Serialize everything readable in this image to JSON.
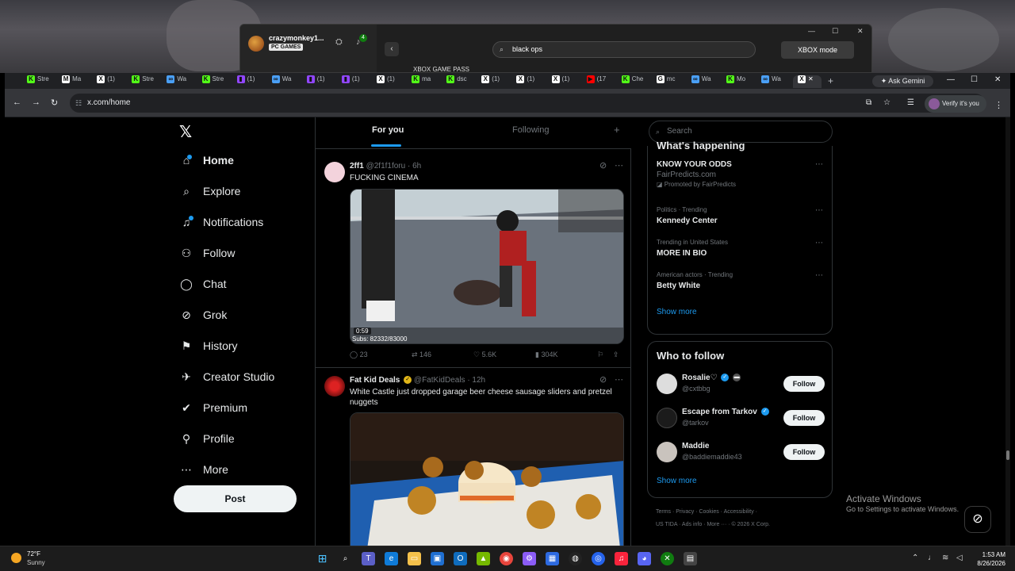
{
  "xbox": {
    "username": "crazymonkey1...",
    "badge": "PC GAMES",
    "notif_count": "4",
    "search_value": "black ops",
    "mode_label": "XBOX mode",
    "game_pass": "XBOX GAME PASS"
  },
  "browser": {
    "tabs": [
      {
        "label": "Stre",
        "fav": "K",
        "color": "#53fc18"
      },
      {
        "label": "Ma",
        "fav": "M",
        "color": "#ffffff"
      },
      {
        "label": "(1)",
        "fav": "X",
        "color": "#ffffff"
      },
      {
        "label": "Stre",
        "fav": "K",
        "color": "#53fc18"
      },
      {
        "label": "Wa",
        "fav": "∞",
        "color": "#4a9ff5"
      },
      {
        "label": "Stre",
        "fav": "K",
        "color": "#53fc18"
      },
      {
        "label": "(1)",
        "fav": "▮",
        "color": "#9146ff"
      },
      {
        "label": "Wa",
        "fav": "∞",
        "color": "#4a9ff5"
      },
      {
        "label": "(1)",
        "fav": "▮",
        "color": "#9146ff"
      },
      {
        "label": "(1)",
        "fav": "▮",
        "color": "#9146ff"
      },
      {
        "label": "(1)",
        "fav": "X",
        "color": "#ffffff"
      },
      {
        "label": "ma",
        "fav": "K",
        "color": "#53fc18"
      },
      {
        "label": "dsc",
        "fav": "K",
        "color": "#53fc18"
      },
      {
        "label": "(1)",
        "fav": "X",
        "color": "#ffffff"
      },
      {
        "label": "(1)",
        "fav": "X",
        "color": "#ffffff"
      },
      {
        "label": "(1)",
        "fav": "X",
        "color": "#ffffff"
      },
      {
        "label": "(17",
        "fav": "▶",
        "color": "#ff0000"
      },
      {
        "label": "Che",
        "fav": "K",
        "color": "#53fc18"
      },
      {
        "label": "mc",
        "fav": "G",
        "color": "#ffffff"
      },
      {
        "label": "Wa",
        "fav": "∞",
        "color": "#4a9ff5"
      },
      {
        "label": "Mo",
        "fav": "K",
        "color": "#53fc18"
      },
      {
        "label": "Wa",
        "fav": "∞",
        "color": "#4a9ff5"
      }
    ],
    "active_tab": {
      "fav": "X",
      "close": "✕"
    },
    "new_tab": "+",
    "gemini": "Ask Gemini",
    "url": "x.com/home",
    "verify": "Verify it's you"
  },
  "nav": {
    "logo": "𝕏",
    "items": [
      {
        "label": "Home",
        "icon": "⌂"
      },
      {
        "label": "Explore",
        "icon": "⌕"
      },
      {
        "label": "Notifications",
        "icon": "♫"
      },
      {
        "label": "Follow",
        "icon": "⚇"
      },
      {
        "label": "Chat",
        "icon": "◯"
      },
      {
        "label": "Grok",
        "icon": "⊘"
      },
      {
        "label": "History",
        "icon": "⚑"
      },
      {
        "label": "Creator Studio",
        "icon": "✈"
      },
      {
        "label": "Premium",
        "icon": "✔"
      },
      {
        "label": "Profile",
        "icon": "⚲"
      },
      {
        "label": "More",
        "icon": "⋯"
      }
    ],
    "post": "Post"
  },
  "feed": {
    "tabs": [
      "For you",
      "Following"
    ],
    "tweet1": {
      "name": "2ff1",
      "handle": "@2f1f1foru · 6h",
      "text": "FUCKING CINEMA",
      "timer": "0:59",
      "overlay": "Subs: 82332/83000",
      "replies": "23",
      "reposts": "146",
      "likes": "5.6K",
      "views": "304K"
    },
    "tweet2": {
      "name": "Fat Kid Deals",
      "handle": "@FatKidDeals · 12h",
      "text": "White Castle just dropped garage beer cheese sausage sliders and pretzel nuggets"
    }
  },
  "right": {
    "search_placeholder": "Search",
    "happening_title": "What's happening",
    "trends": [
      {
        "title": "KNOW YOUR ODDS",
        "meta": "FairPredicts.com",
        "sub": "Promoted by FairPredicts"
      },
      {
        "meta": "Politics · Trending",
        "title": "Kennedy Center"
      },
      {
        "meta": "Trending in United States",
        "title": "MORE IN BIO"
      },
      {
        "meta": "American actors · Trending",
        "title": "Betty White"
      }
    ],
    "show_more": "Show more",
    "wtf_title": "Who to follow",
    "follow": [
      {
        "name": "Rosalie♡",
        "handle": "@cxtbbg"
      },
      {
        "name": "Escape from Tarkov",
        "handle": "@tarkov"
      },
      {
        "name": "Maddie",
        "handle": "@baddiemaddie43"
      }
    ],
    "follow_label": "Follow",
    "footer1": "Terms  ·  Privacy  ·  Cookies  ·  Accessibility  ·",
    "footer2": "US TIDA  ·  Ads info  ·  More ···  ·  © 2026 X Corp."
  },
  "windows": {
    "activate_title": "Activate Windows",
    "activate_sub": "Go to Settings to activate Windows."
  },
  "taskbar": {
    "temp": "72°F",
    "condition": "Sunny",
    "time": "1:53 AM",
    "date": "8/26/2026"
  }
}
